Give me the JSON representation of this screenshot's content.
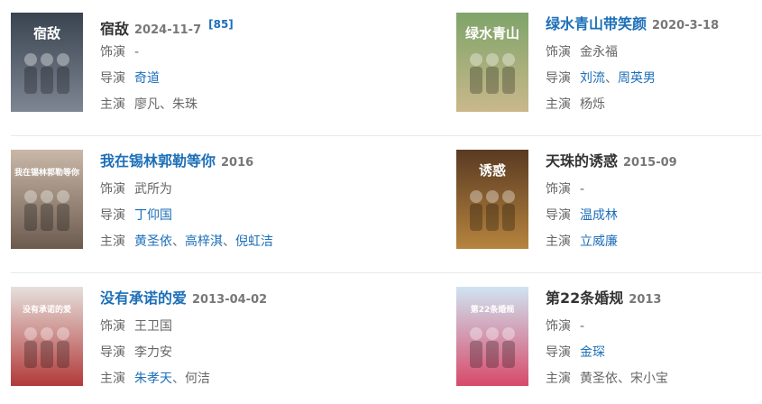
{
  "labels": {
    "actor": "饰演",
    "director": "导演",
    "starring": "主演"
  },
  "items": [
    {
      "title": "宿敌",
      "title_link": false,
      "date": "2024-11-7",
      "badge": "[85]",
      "actor": "-",
      "actor_link": false,
      "director_parts": [
        "奇道"
      ],
      "director_link": true,
      "starring_parts": [
        "廖凡、朱珠"
      ],
      "starring_link": false,
      "poster_text": "宿敌",
      "poster_colors": [
        "#3a4450",
        "#7d8692"
      ]
    },
    {
      "title": "绿水青山带笑颜",
      "title_link": true,
      "date": "2020-3-18",
      "badge": "",
      "actor": "金永福",
      "actor_link": false,
      "director_parts": [
        "刘流",
        "周英男"
      ],
      "director_link": true,
      "starring_parts": [
        "杨烁"
      ],
      "starring_link": false,
      "poster_text": "绿水青山",
      "poster_colors": [
        "#7fa46a",
        "#c9b88a"
      ]
    },
    {
      "title": "我在锡林郭勒等你",
      "title_link": true,
      "date": "2016",
      "badge": "",
      "actor": "武所为",
      "actor_link": false,
      "director_parts": [
        "丁仰国"
      ],
      "director_link": true,
      "starring_parts": [
        "黄圣依",
        "高梓淇",
        "倪虹洁"
      ],
      "starring_link": true,
      "poster_text": "我在锡林郭勒等你",
      "poster_colors": [
        "#c9b8a8",
        "#6b5a4e"
      ]
    },
    {
      "title": "天珠的诱惑",
      "title_link": false,
      "date": "2015-09",
      "badge": "",
      "actor": "-",
      "actor_link": false,
      "director_parts": [
        "温成林"
      ],
      "director_link": true,
      "starring_parts": [
        "立威廉"
      ],
      "starring_link": true,
      "poster_text": "诱惑",
      "poster_colors": [
        "#5a3a22",
        "#b6843e"
      ]
    },
    {
      "title": "没有承诺的爱",
      "title_link": true,
      "date": "2013-04-02",
      "badge": "",
      "actor": "王卫国",
      "actor_link": false,
      "director_parts": [
        "李力安"
      ],
      "director_link": false,
      "starring_parts": [
        "朱孝天",
        "何洁"
      ],
      "starring_link_first": true,
      "poster_text": "没有承诺的爱",
      "poster_colors": [
        "#e6e0dc",
        "#b23a3a"
      ]
    },
    {
      "title": "第22条婚规",
      "title_link": false,
      "date": "2013",
      "badge": "",
      "actor": "-",
      "actor_link": false,
      "director_parts": [
        "金琛"
      ],
      "director_link": true,
      "starring_parts": [
        "黄圣依、宋小宝"
      ],
      "starring_link": false,
      "poster_text": "第22条婚规",
      "poster_colors": [
        "#cfe4f2",
        "#d74a6a"
      ]
    }
  ]
}
